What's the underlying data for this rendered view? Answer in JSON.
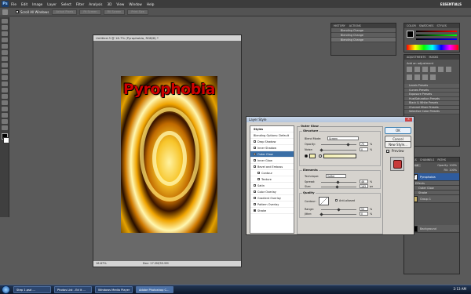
{
  "app": {
    "menus": [
      "File",
      "Edit",
      "Image",
      "Layer",
      "Select",
      "Filter",
      "Analysis",
      "3D",
      "View",
      "Window",
      "Help"
    ],
    "workspace": "ESSENTIALS",
    "options": {
      "scroll_all": "Scroll All Windows",
      "btn1": "Actual Pixels",
      "btn2": "Fit Screen",
      "btn3": "Fill Screen",
      "btn4": "Print Size"
    }
  },
  "document": {
    "title": "Untitled-3 @ 16.7% (Pyrophobia, RGB/8) *",
    "zoom": "16.67%",
    "doc_size": "Doc: 17.2M/55.9M",
    "text_layer": "Pyrophobia"
  },
  "history": {
    "tabs": [
      "HISTORY",
      "ACTIONS"
    ],
    "items": [
      "Blending Change",
      "Blending Change",
      "Blending Change"
    ]
  },
  "color_panel": {
    "tabs": [
      "COLOR",
      "SWATCHES",
      "STYLES"
    ]
  },
  "adjustments": {
    "tabs": [
      "ADJUSTMENTS",
      "MASKS"
    ],
    "heading": "Add an adjustment",
    "presets": [
      "Levels Presets",
      "Curves Presets",
      "Exposure Presets",
      "Hue/Saturation Presets",
      "Black & White Presets",
      "Channel Mixer Presets",
      "Selective Color Presets"
    ]
  },
  "layers": {
    "tabs": [
      "LAYERS",
      "CHANNELS",
      "PATHS"
    ],
    "blend_mode": "Normal",
    "opacity": "Opacity: 100%",
    "fill": "Fill: 100%",
    "items": [
      {
        "name": "Pyrophobia",
        "kind": "text"
      },
      {
        "name": "Effects",
        "kind": "fx"
      },
      {
        "name": "Outer Glow",
        "kind": "effect"
      },
      {
        "name": "Stroke",
        "kind": "effect"
      },
      {
        "name": "Group 1",
        "kind": "group"
      },
      {
        "name": "Background",
        "kind": "bg"
      }
    ]
  },
  "dialog": {
    "title": "Layer Style",
    "styles": [
      {
        "label": "Styles",
        "checked": null
      },
      {
        "label": "Blending Options: Default",
        "checked": null
      },
      {
        "label": "Drop Shadow",
        "checked": false
      },
      {
        "label": "Inner Shadow",
        "checked": false
      },
      {
        "label": "Outer Glow",
        "checked": true,
        "selected": true
      },
      {
        "label": "Inner Glow",
        "checked": false
      },
      {
        "label": "Bevel and Emboss",
        "checked": false
      },
      {
        "label": "Contour",
        "checked": false,
        "sub": true
      },
      {
        "label": "Texture",
        "checked": false,
        "sub": true
      },
      {
        "label": "Satin",
        "checked": false
      },
      {
        "label": "Color Overlay",
        "checked": false
      },
      {
        "label": "Gradient Overlay",
        "checked": false
      },
      {
        "label": "Pattern Overlay",
        "checked": false
      },
      {
        "label": "Stroke",
        "checked": true
      }
    ],
    "section_title": "Outer Glow",
    "structure": {
      "label": "Structure",
      "blend_mode_label": "Blend Mode:",
      "blend_mode": "Screen",
      "opacity_label": "Opacity:",
      "opacity": "75",
      "noise_label": "Noise:",
      "noise": "0",
      "unit": "%"
    },
    "elements": {
      "label": "Elements",
      "technique_label": "Technique:",
      "technique": "Softer",
      "spread_label": "Spread:",
      "spread": "46",
      "size_label": "Size:",
      "size": "163",
      "spread_unit": "%",
      "size_unit": "px"
    },
    "quality": {
      "label": "Quality",
      "contour_label": "Contour:",
      "antialiased": "Anti-aliased",
      "range_label": "Range:",
      "range": "50",
      "jitter_label": "Jitter:",
      "jitter": "0",
      "unit": "%"
    },
    "buttons": {
      "ok": "OK",
      "cancel": "Cancel",
      "new_style": "New Style...",
      "preview": "Preview"
    },
    "glow_color": "#f3efb1",
    "preview_color": "#c83a3a"
  },
  "taskbar": {
    "items": [
      "Step 1.psd ...",
      "Photos List - Ed it ...",
      "Windows Media Player",
      "Adobe Photoshop C..."
    ],
    "clock": "2:13 AM"
  }
}
